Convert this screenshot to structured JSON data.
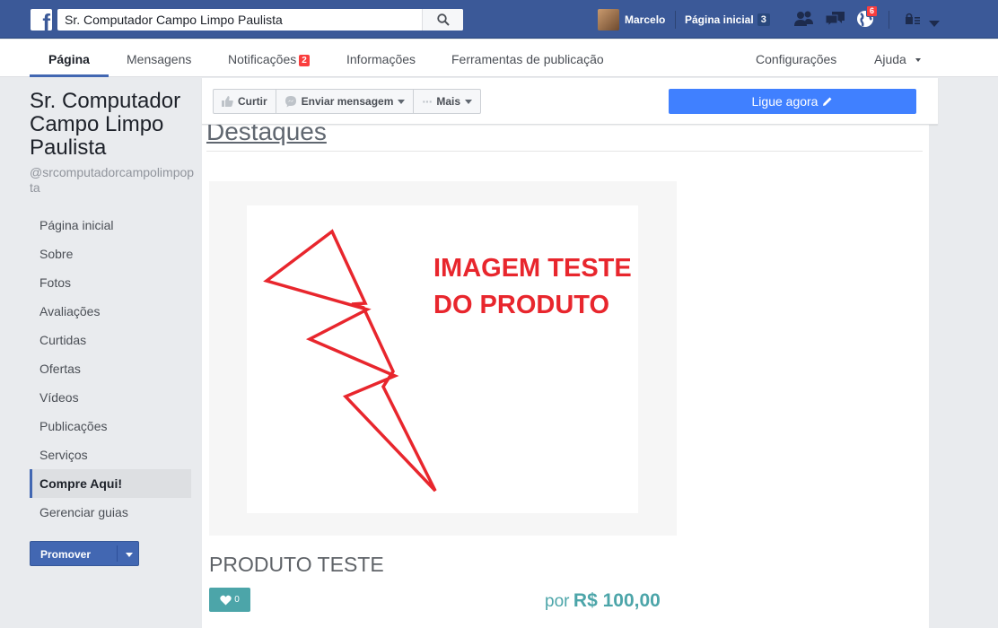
{
  "topbar": {
    "search_value": "Sr. Computador Campo Limpo Paulista",
    "user_name": "Marcelo",
    "home_label": "Página inicial",
    "home_count": "3",
    "notifications_count": "6"
  },
  "tabs": {
    "pagina": "Página",
    "mensagens": "Mensagens",
    "notificacoes": "Notificações",
    "notificacoes_badge": "2",
    "informacoes": "Informações",
    "ferramentas": "Ferramentas de publicação",
    "configuracoes": "Configurações",
    "ajuda": "Ajuda"
  },
  "page": {
    "name": "Sr. Computador Campo Limpo Paulista",
    "username": "@srcomputadorcampolimpopta"
  },
  "sidebar": {
    "items": [
      {
        "label": "Página inicial",
        "active": false
      },
      {
        "label": "Sobre",
        "active": false
      },
      {
        "label": "Fotos",
        "active": false
      },
      {
        "label": "Avaliações",
        "active": false
      },
      {
        "label": "Curtidas",
        "active": false
      },
      {
        "label": "Ofertas",
        "active": false
      },
      {
        "label": "Vídeos",
        "active": false
      },
      {
        "label": "Publicações",
        "active": false
      },
      {
        "label": "Serviços",
        "active": false
      },
      {
        "label": "Compre Aqui!",
        "active": true
      },
      {
        "label": "Gerenciar guias",
        "active": false
      }
    ],
    "promote_label": "Promover"
  },
  "actions": {
    "like": "Curtir",
    "send_message": "Enviar mensagem",
    "more": "Mais",
    "call": "Ligue agora"
  },
  "content": {
    "section_title": "Destaques",
    "image_caption_line1": "IMAGEM TESTE",
    "image_caption_line2": "DO PRODUTO",
    "product_title": "PRODUTO TESTE",
    "likes_count": "0",
    "price_prefix": "por",
    "price_value": "R$ 100,00"
  },
  "colors": {
    "facebook_blue": "#3b5998",
    "accent_blue": "#4267b2",
    "call_button": "#4080ff",
    "teal": "#4ca5a9",
    "lightning_red": "#e8262d"
  }
}
